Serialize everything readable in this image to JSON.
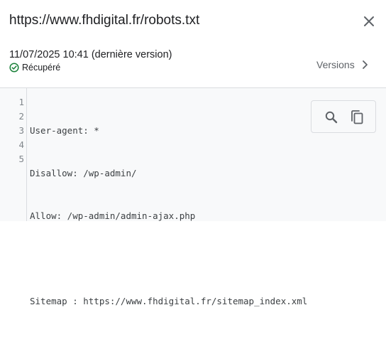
{
  "header": {
    "title": "https://www.fhdigital.fr/robots.txt",
    "date": "11/07/2025 10:41 (dernière version)",
    "status": "Récupéré",
    "versions_label": "Versions"
  },
  "code": {
    "lines": [
      {
        "number": "1",
        "text": "User-agent: *"
      },
      {
        "number": "2",
        "text": "Disallow: /wp-admin/"
      },
      {
        "number": "3",
        "text": "Allow: /wp-admin/admin-ajax.php"
      },
      {
        "number": "4",
        "text": ""
      },
      {
        "number": "5",
        "text": "Sitemap : https://www.fhdigital.fr/sitemap_index.xml"
      }
    ]
  },
  "icons": {
    "close": "close-icon",
    "status": "check-circle-icon",
    "versions": "chevron-right-icon",
    "search": "search-icon",
    "copy": "copy-icon"
  },
  "colors": {
    "status_green": "#188038",
    "icon_gray": "#5f6368",
    "code_background": "#f8f9fa",
    "divider": "#dadce0"
  }
}
